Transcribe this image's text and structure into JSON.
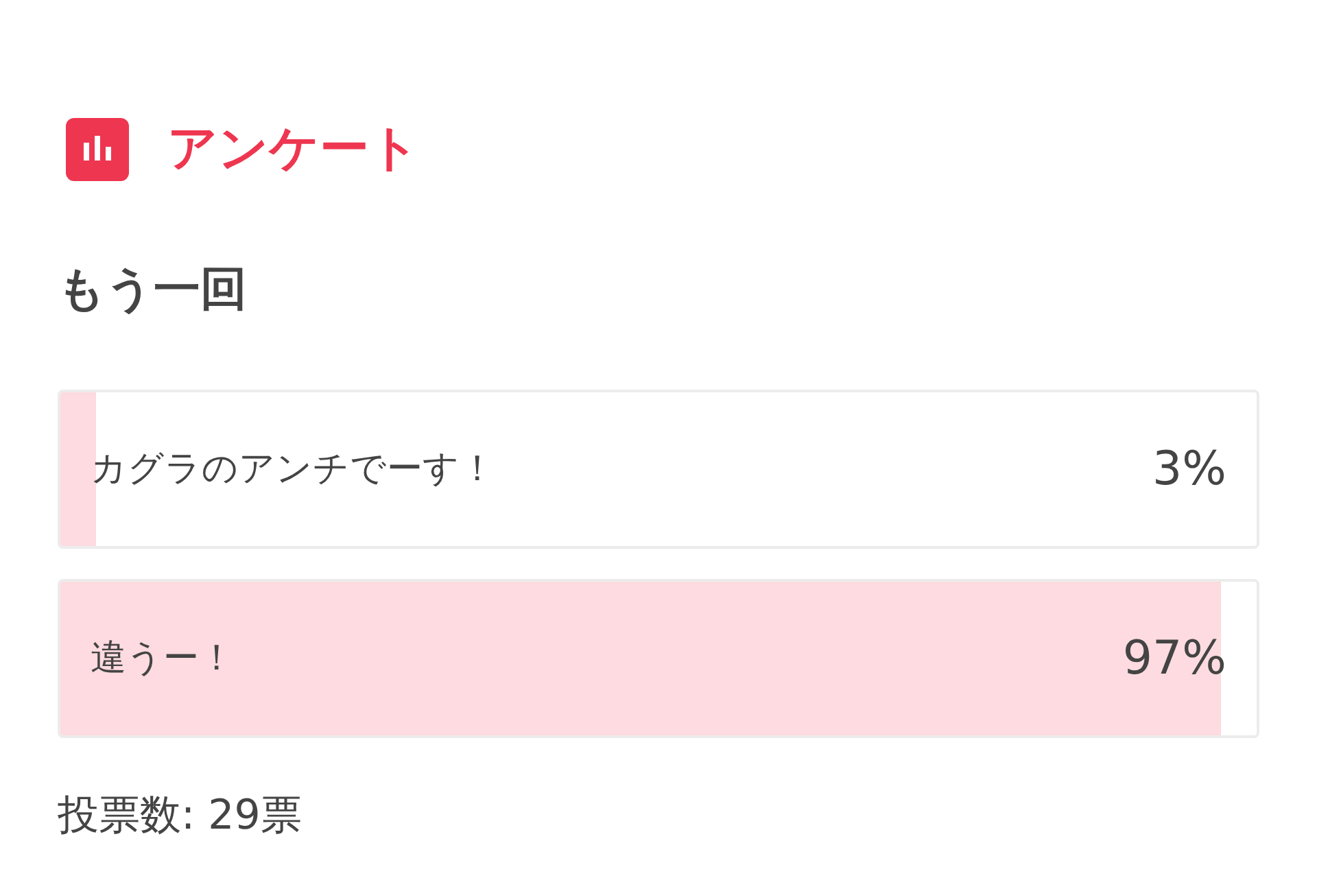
{
  "header": {
    "title": "アンケート"
  },
  "question": "もう一回",
  "options": [
    {
      "label": "カグラのアンチでーす！",
      "percent": "3%",
      "level": 0.03
    },
    {
      "label": "違うー！",
      "percent": "97%",
      "level": 0.97
    }
  ],
  "footer": "投票数: 29票"
}
